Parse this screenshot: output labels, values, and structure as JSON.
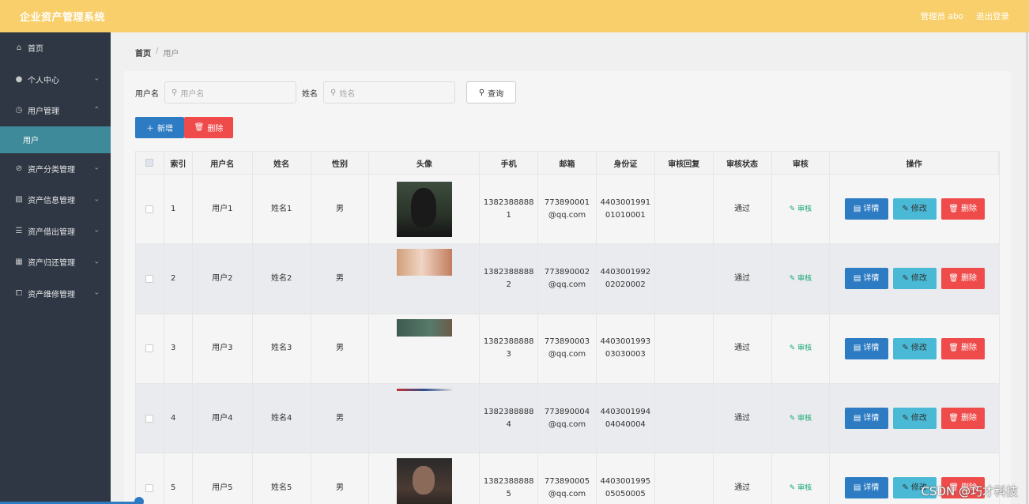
{
  "header": {
    "title": "企业资产管理系统",
    "user": "管理员 abo",
    "logout": "退出登录"
  },
  "sidebar": {
    "items": [
      {
        "label": "首页",
        "icon": "⌂"
      },
      {
        "label": "个人中心",
        "icon": "●"
      },
      {
        "label": "用户管理",
        "icon": "◷"
      },
      {
        "label": "资产分类管理",
        "icon": "⊘"
      },
      {
        "label": "资产信息管理",
        "icon": "▨"
      },
      {
        "label": "资产借出管理",
        "icon": "☰"
      },
      {
        "label": "资产归还管理",
        "icon": "▦"
      },
      {
        "label": "资产维修管理",
        "icon": "⧠"
      }
    ],
    "active_sub": "用户"
  },
  "breadcrumb": {
    "home": "首页",
    "current": "用户"
  },
  "search": {
    "username_label": "用户名",
    "username_placeholder": "用户名",
    "name_label": "姓名",
    "name_placeholder": "姓名",
    "button": "查询"
  },
  "actions": {
    "add": "新增",
    "delete": "删除"
  },
  "table": {
    "headers": [
      "索引",
      "用户名",
      "姓名",
      "性别",
      "头像",
      "手机",
      "邮箱",
      "身份证",
      "审核回复",
      "审核状态",
      "审核",
      "操作"
    ],
    "rows": [
      {
        "index": "1",
        "username": "用户1",
        "name": "姓名1",
        "gender": "男",
        "phone": "13823888881",
        "email": "773890001@qq.com",
        "idcard": "440300199101010001",
        "reply": "",
        "status": "通过",
        "audit": "审核"
      },
      {
        "index": "2",
        "username": "用户2",
        "name": "姓名2",
        "gender": "男",
        "phone": "13823888882",
        "email": "773890002@qq.com",
        "idcard": "440300199202020002",
        "reply": "",
        "status": "通过",
        "audit": "审核"
      },
      {
        "index": "3",
        "username": "用户3",
        "name": "姓名3",
        "gender": "男",
        "phone": "13823888883",
        "email": "773890003@qq.com",
        "idcard": "440300199303030003",
        "reply": "",
        "status": "通过",
        "audit": "审核"
      },
      {
        "index": "4",
        "username": "用户4",
        "name": "姓名4",
        "gender": "男",
        "phone": "13823888884",
        "email": "773890004@qq.com",
        "idcard": "440300199404040004",
        "reply": "",
        "status": "通过",
        "audit": "审核"
      },
      {
        "index": "5",
        "username": "用户5",
        "name": "姓名5",
        "gender": "男",
        "phone": "13823888885",
        "email": "773890005@qq.com",
        "idcard": "440300199505050005",
        "reply": "",
        "status": "通过",
        "audit": "审核"
      }
    ],
    "ops": {
      "detail": "详情",
      "edit": "修改",
      "delete": "删除"
    }
  },
  "watermark": "CSDN @巧才科技",
  "colors": {
    "header": "#f8cf6b",
    "sidebar": "#2f3745",
    "active": "#3e8a9b",
    "primary": "#2d7bc3",
    "danger": "#ef4b4b",
    "info": "#4ab9d5",
    "success": "#1aa874"
  }
}
